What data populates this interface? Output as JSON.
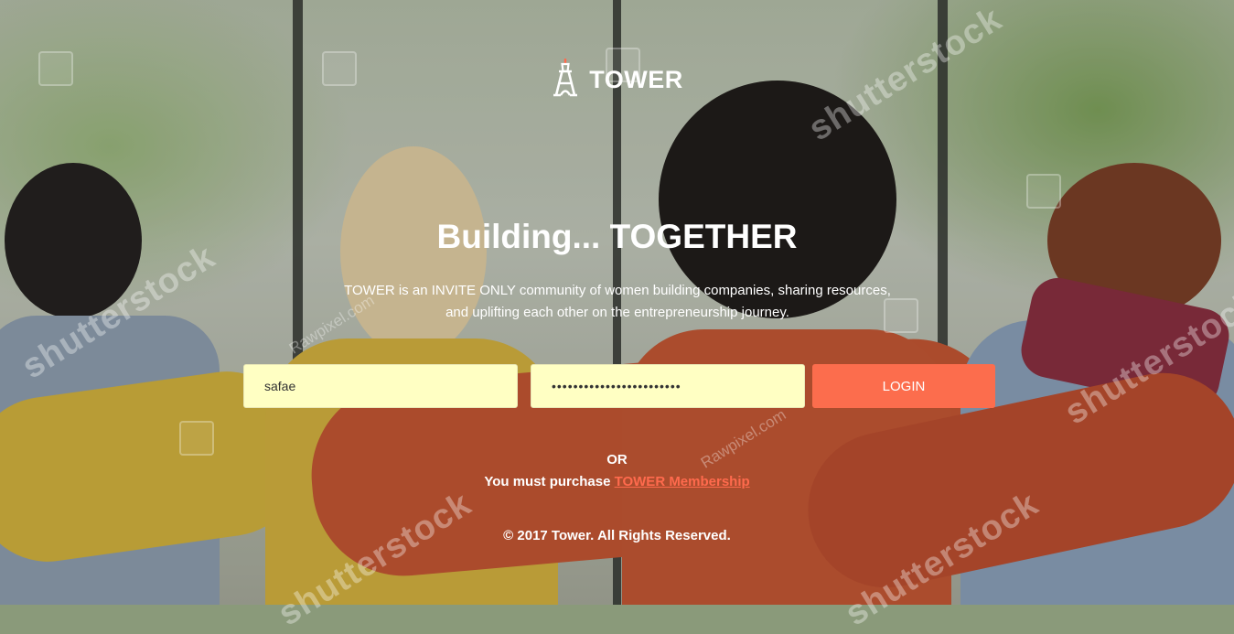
{
  "brand": {
    "name": "TOWER",
    "icon": "eiffel-tower-icon"
  },
  "hero": {
    "headline": "Building... TOGETHER",
    "description_line1": "TOWER is an INVITE ONLY community of women building companies, sharing resources,",
    "description_line2": "and uplifting each other on the entrepreneurship journey."
  },
  "login_form": {
    "username_value": "safae",
    "password_value": "••••••••••••••••••••••••",
    "login_label": "LOGIN"
  },
  "alt": {
    "or_text": "OR",
    "purchase_prefix": "You must purchase ",
    "purchase_link": "TOWER Membership"
  },
  "footer": {
    "copyright": "© 2017 Tower. All Rights Reserved."
  },
  "watermarks": {
    "shutterstock": "shutterstock",
    "rawpixel": "Rawpixel.com"
  },
  "colors": {
    "accent": "#fc6d4d",
    "input_bg": "#ffffc3",
    "text": "#ffffff"
  }
}
